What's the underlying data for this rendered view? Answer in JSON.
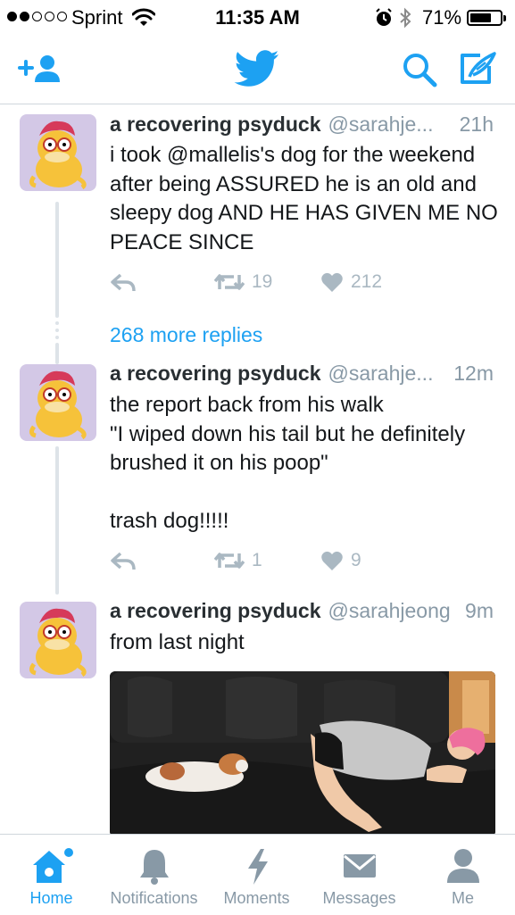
{
  "status_bar": {
    "carrier": "Sprint",
    "time": "11:35 AM",
    "battery_pct": "71%",
    "battery_level": 0.71,
    "signal_bars": 2
  },
  "nav": {
    "left_icon": "add-user-icon",
    "center_icon": "twitter-bird-icon",
    "right_icons": [
      "search-icon",
      "compose-icon"
    ],
    "accent": "#1da1f2"
  },
  "tweets": [
    {
      "name": "a recovering psyduck",
      "handle": "@sarahje...",
      "time": "21h",
      "text": "i took @mallelis's dog for the weekend after being ASSURED he is an old and sleepy dog AND HE HAS GIVEN ME NO PEACE SINCE",
      "retweets": "19",
      "likes": "212"
    },
    {
      "name": "a recovering psyduck",
      "handle": "@sarahje...",
      "time": "12m",
      "text": "the report back from his walk\n\"I wiped down his tail but he definitely brushed it on his poop\"\n\ntrash dog!!!!!",
      "retweets": "1",
      "likes": "9"
    },
    {
      "name": "a recovering psyduck",
      "handle": "@sarahjeong",
      "time": "9m",
      "text": "from last night"
    }
  ],
  "more_replies": "268 more replies",
  "tabs": [
    {
      "label": "Home",
      "icon": "home-icon",
      "active": true
    },
    {
      "label": "Notifications",
      "icon": "bell-icon",
      "active": false
    },
    {
      "label": "Moments",
      "icon": "lightning-icon",
      "active": false
    },
    {
      "label": "Messages",
      "icon": "envelope-icon",
      "active": false
    },
    {
      "label": "Me",
      "icon": "person-icon",
      "active": false
    }
  ]
}
